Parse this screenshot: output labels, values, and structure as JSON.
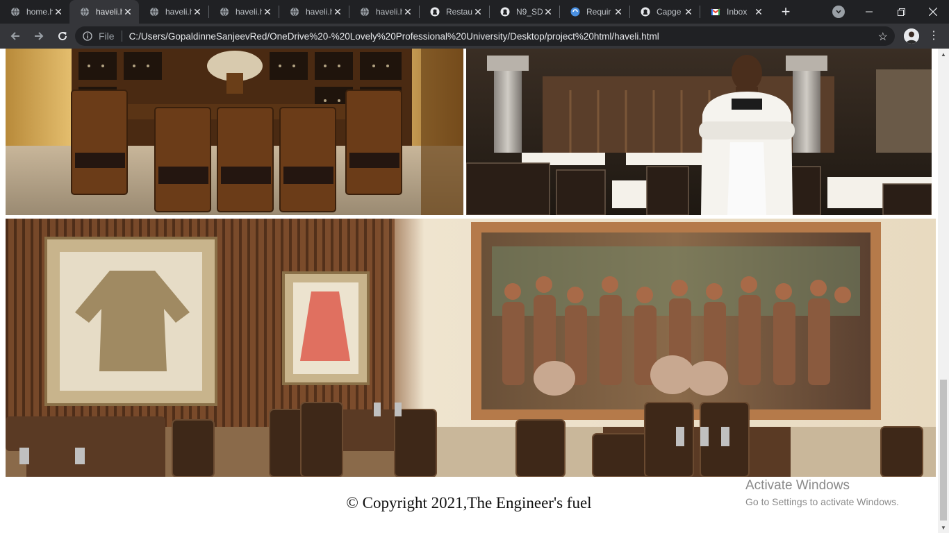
{
  "browser": {
    "tabs": [
      {
        "title": "home.h",
        "icon": "globe-icon",
        "active": false
      },
      {
        "title": "haveli.h",
        "icon": "globe-icon",
        "active": true
      },
      {
        "title": "haveli.h",
        "icon": "globe-icon",
        "active": false
      },
      {
        "title": "haveli.h",
        "icon": "globe-icon",
        "active": false
      },
      {
        "title": "haveli.h",
        "icon": "globe-icon",
        "active": false
      },
      {
        "title": "haveli.h",
        "icon": "globe-icon",
        "active": false
      },
      {
        "title": "Restau",
        "icon": "github-icon",
        "active": false
      },
      {
        "title": "N9_SD",
        "icon": "github-icon",
        "active": false
      },
      {
        "title": "Requir",
        "icon": "blue-circle-icon",
        "active": false
      },
      {
        "title": "Capge",
        "icon": "github-icon",
        "active": false
      },
      {
        "title": "Inbox",
        "icon": "gmail-icon",
        "active": false
      }
    ],
    "new_tab_glyph": "+",
    "address": {
      "scheme": "File",
      "url": "C:/Users/GopaldinneSanjeevRed/OneDrive%20-%20Lovely%20Professional%20University/Desktop/project%20html/haveli.html"
    },
    "close_glyph": "✕",
    "star_glyph": "☆",
    "menu_glyph": "⋮"
  },
  "page": {
    "images": [
      {
        "name": "private-dining-room-photo",
        "alt": "private dining room with wine cabinets"
      },
      {
        "name": "chef-restaurant-photo",
        "alt": "chef standing in restaurant hall"
      },
      {
        "name": "heritage-dining-hall-photo",
        "alt": "dining hall with framed garments and mural"
      }
    ],
    "footer": "© Copyright 2021,The Engineer's fuel"
  },
  "os_overlay": {
    "title": "Activate Windows",
    "subtitle": "Go to Settings to activate Windows."
  },
  "colors": {
    "tabstrip": "#202124",
    "toolbar": "#35363a",
    "omnibox": "#202124"
  }
}
